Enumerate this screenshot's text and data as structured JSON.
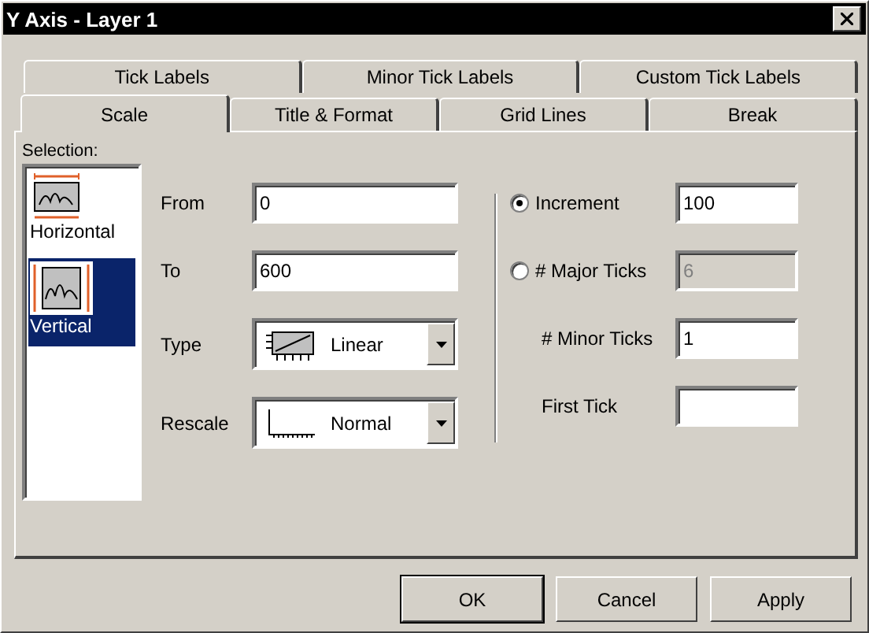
{
  "window": {
    "title": "Y Axis - Layer 1"
  },
  "tab_rows": [
    [
      {
        "label": "Tick Labels",
        "selected": false
      },
      {
        "label": "Minor Tick Labels",
        "selected": false
      },
      {
        "label": "Custom Tick Labels",
        "selected": false
      }
    ],
    [
      {
        "label": "Scale",
        "selected": true
      },
      {
        "label": "Title & Format",
        "selected": false
      },
      {
        "label": "Grid Lines",
        "selected": false
      },
      {
        "label": "Break",
        "selected": false
      }
    ]
  ],
  "selection": {
    "label": "Selection:",
    "items": [
      {
        "label": "Horizontal",
        "kind": "horizontal",
        "selected": false
      },
      {
        "label": "Vertical",
        "kind": "vertical",
        "selected": true
      }
    ]
  },
  "range_fields": [
    {
      "label": "From",
      "value": "0"
    },
    {
      "label": "To",
      "value": "600"
    }
  ],
  "dropdowns": [
    {
      "label": "Type",
      "kind": "linear",
      "value": "Linear"
    },
    {
      "label": "Rescale",
      "kind": "normal",
      "value": "Normal"
    }
  ],
  "tick_options": [
    {
      "kind": "radio",
      "label": "Increment",
      "selected": true,
      "value": "100",
      "disabled": false
    },
    {
      "kind": "radio",
      "label": "# Major Ticks",
      "selected": false,
      "value": "6",
      "disabled": true
    },
    {
      "kind": "plain",
      "label": "# Minor Ticks",
      "value": "1",
      "disabled": false
    },
    {
      "kind": "plain",
      "label": "First Tick",
      "disabled": false
    }
  ],
  "buttons": [
    {
      "label": "OK",
      "default": true
    },
    {
      "label": "Cancel",
      "default": false
    },
    {
      "label": "Apply",
      "default": false
    }
  ]
}
